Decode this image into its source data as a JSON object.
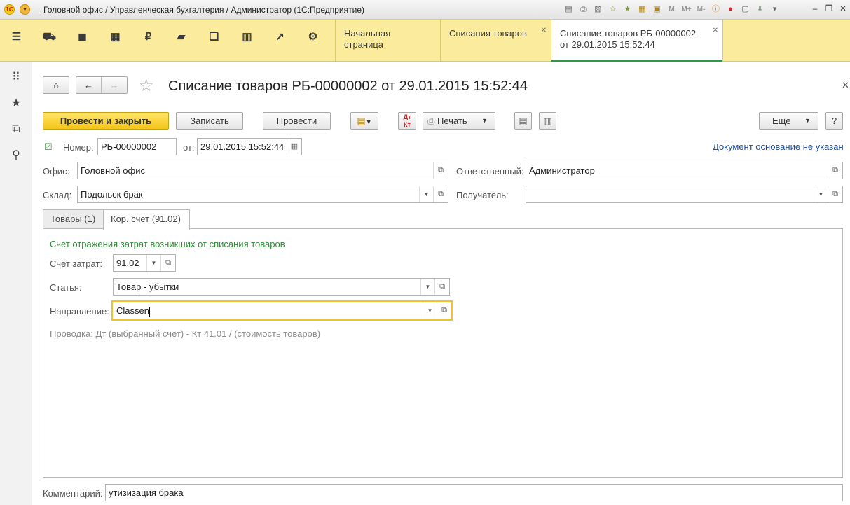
{
  "window": {
    "title": "Головной офис / Управленческая бухгалтерия / Администратор  (1С:Предприятие)",
    "logo_text": "1С",
    "tool_icons": [
      "save-icon",
      "print-icon",
      "preview-icon",
      "favorite-add-icon",
      "favorite-icon",
      "calculator-icon",
      "calendar-icon"
    ],
    "memory_labels": [
      "M",
      "M+",
      "M-"
    ]
  },
  "open_tabs": [
    {
      "label": "Начальная страница"
    },
    {
      "label": "Списания товаров"
    },
    {
      "label": "Списание товаров РБ-00000002",
      "label2": "от 29.01.2015 15:52:44"
    }
  ],
  "form": {
    "title": "Списание товаров РБ-00000002 от 29.01.2015 15:52:44",
    "buttons": {
      "post_close": "Провести и закрыть",
      "save": "Записать",
      "post": "Провести",
      "print": "Печать",
      "more": "Еще",
      "help": "?"
    },
    "number_label": "Номер:",
    "number_value": "РБ-00000002",
    "date_label": "от:",
    "date_value": "29.01.2015 15:52:44",
    "base_document_link": "Документ основание не указан",
    "office_label": "Офис:",
    "office_value": "Головной офис",
    "responsible_label": "Ответственный:",
    "responsible_value": "Администратор",
    "warehouse_label": "Склад:",
    "warehouse_value": "Подольск брак",
    "recipient_label": "Получатель:",
    "recipient_value": "",
    "comment_label": "Комментарий:",
    "comment_value": "утизизация брака"
  },
  "tabs": [
    {
      "label": "Товары (1)"
    },
    {
      "label": "Кор. счет (91.02)"
    }
  ],
  "account_tab": {
    "heading": "Счет отражения затрат возникших от списания товаров",
    "expense_account_label": "Счет затрат:",
    "expense_account_value": "91.02",
    "item_label": "Статья:",
    "item_value": "Товар - убытки",
    "direction_label": "Направление:",
    "direction_value": "Classen",
    "posting_note": "Проводка: Дт (выбранный счет) - Кт 41.01  / (стоимость товаров)"
  }
}
